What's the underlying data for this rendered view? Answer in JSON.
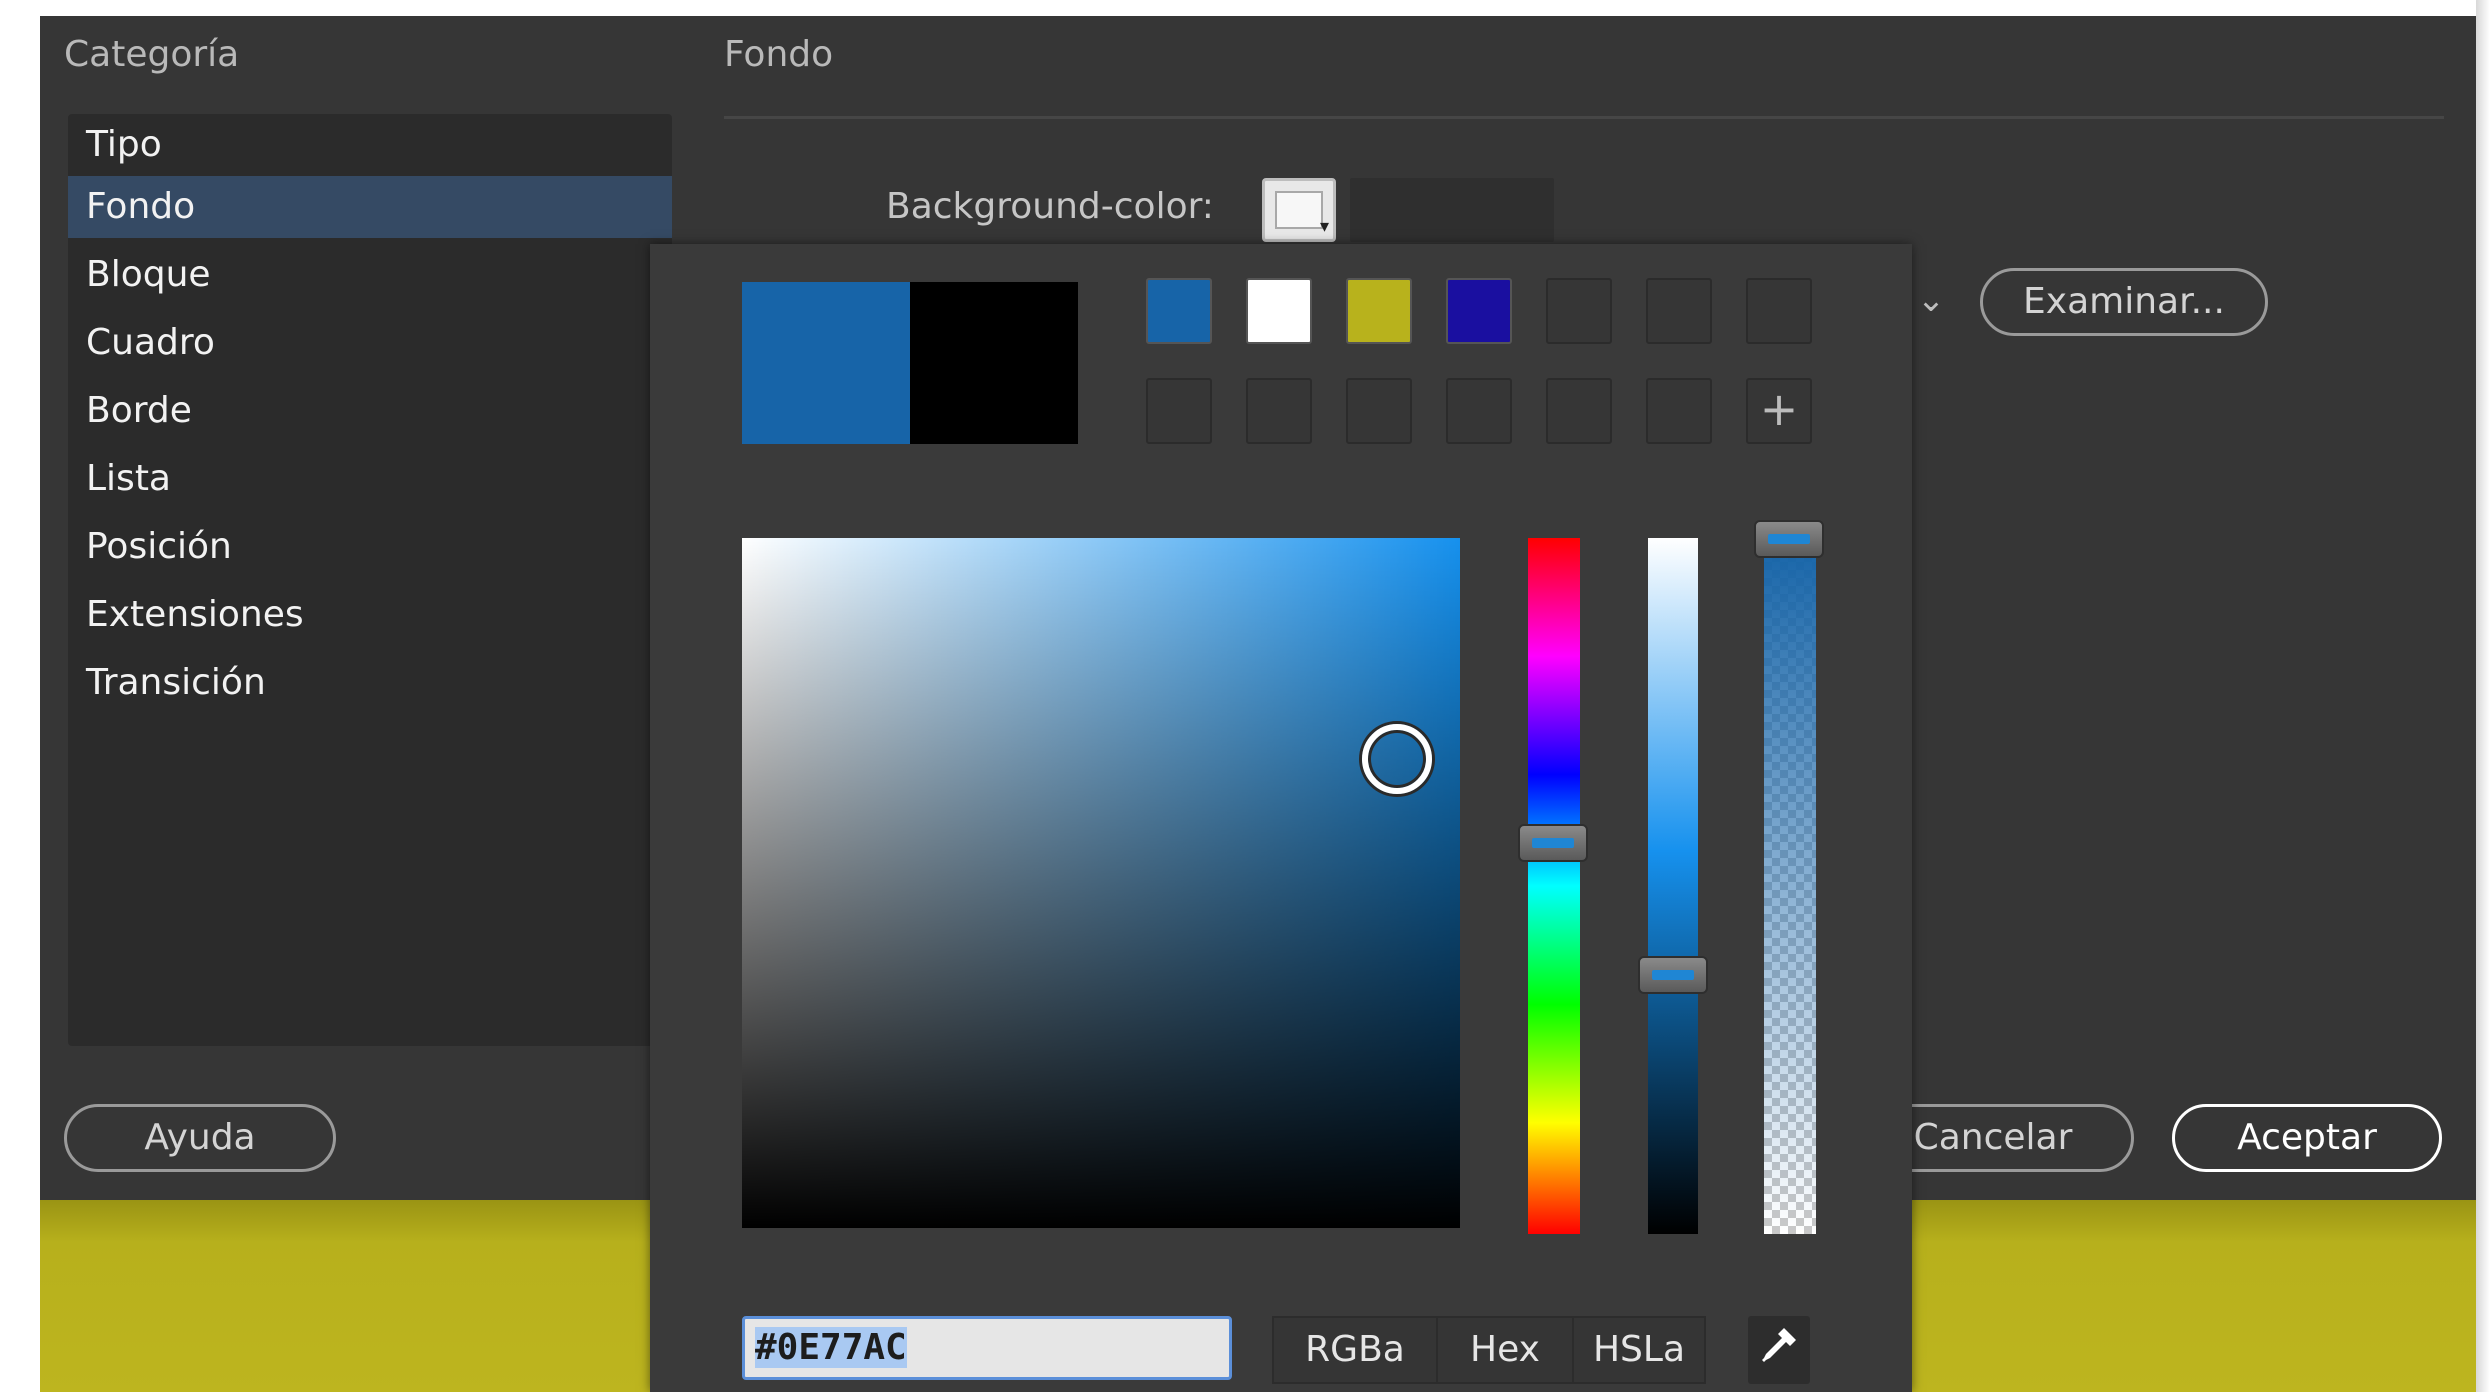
{
  "dialog": {
    "category_label": "Categoría",
    "section_title": "Fondo",
    "categories": [
      "Tipo",
      "Fondo",
      "Bloque",
      "Cuadro",
      "Borde",
      "Lista",
      "Posición",
      "Extensiones",
      "Transición"
    ],
    "active_category": "Fondo",
    "background_color_label": "Background-color:",
    "browse_label": "Examinar...",
    "help_label": "Ayuda",
    "cancel_label": "Cancelar",
    "ok_label": "Aceptar"
  },
  "color_picker": {
    "current_color": "#1764A8",
    "previous_color": "#000000",
    "swatches": [
      "#1764A8",
      "#FFFFFF",
      "#B8B21C",
      "#1A0FA0",
      "",
      "",
      "",
      "",
      "",
      "",
      "",
      "",
      "",
      ""
    ],
    "add_swatch_icon": "+",
    "hex_value": "#0E77AC",
    "modes": [
      "RGBa",
      "Hex",
      "HSLa"
    ],
    "hue_color": "#1691EE",
    "eyedropper_icon": "eyedropper-icon"
  }
}
